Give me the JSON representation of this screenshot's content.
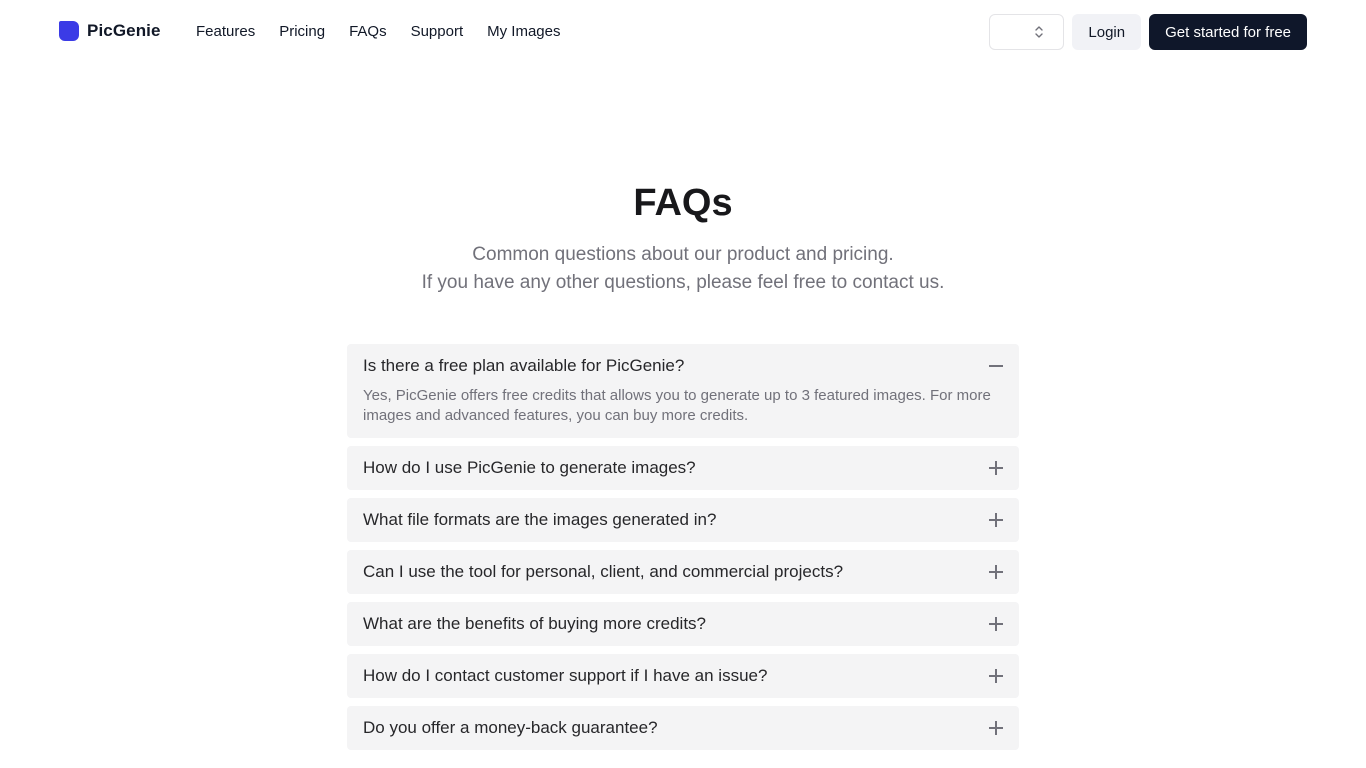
{
  "header": {
    "brand": "PicGenie",
    "nav": [
      "Features",
      "Pricing",
      "FAQs",
      "Support",
      "My Images"
    ],
    "select_value": "",
    "login_label": "Login",
    "cta_label": "Get started for free"
  },
  "hero": {
    "title": "FAQs",
    "subtitle_line1": "Common questions about our product and pricing.",
    "subtitle_line2": "If you have any other questions, please feel free to contact us."
  },
  "faqs": [
    {
      "question": "Is there a free plan available for PicGenie?",
      "answer": "Yes, PicGenie offers free credits that allows you to generate up to 3 featured images. For more images and advanced features, you can buy more credits.",
      "expanded": true
    },
    {
      "question": "How do I use PicGenie to generate images?",
      "expanded": false
    },
    {
      "question": "What file formats are the images generated in?",
      "expanded": false
    },
    {
      "question": "Can I use the tool for personal, client, and commercial projects?",
      "expanded": false
    },
    {
      "question": "What are the benefits of buying more credits?",
      "expanded": false
    },
    {
      "question": "How do I contact customer support if I have an issue?",
      "expanded": false
    },
    {
      "question": "Do you offer a money-back guarantee?",
      "expanded": false
    }
  ],
  "colors": {
    "brand": "#3b3be6",
    "cta_bg": "#0f172a",
    "faq_bg": "#f4f4f5"
  }
}
